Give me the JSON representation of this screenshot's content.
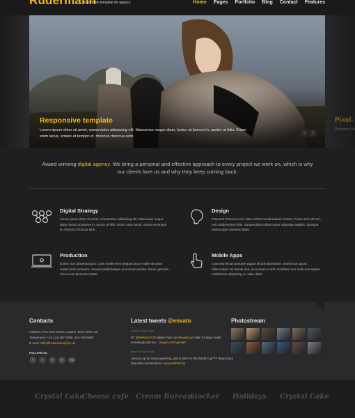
{
  "header": {
    "logo": "Rudermann",
    "tagline": "A portfolio template for agency",
    "nav": [
      "Home",
      "Pages",
      "Portfolio",
      "Blog",
      "Contact",
      "Features"
    ]
  },
  "slider": {
    "title": "Responsive template",
    "text": "Lorem ipsum dolor sit amet, consectetur adipiscing elit. Maecenas neque diam, luctus at laoreet in, auctor ut felis. Etiam enim lacus, ornare et tempor et, rhoncus rhoncus sem.",
    "next_peek_title": "Pixel-",
    "next_peek_text": "Praesent / rhoncus / rhoncus",
    "prev_arrow": "‹",
    "next_arrow": "›"
  },
  "intro": {
    "before": "Award winning ",
    "highlight": "digital agency",
    "after": ". We bring a personal and effective approach to every project we work on, which is why our clients love us and why they keep coming back."
  },
  "features": [
    {
      "title": "Digital Strategy",
      "icon": "network-icon",
      "text": "Lorem ipsum dolor sit amet, consectetur adipiscing elit. Maecenas neque diam, luctus at laoreet in, auctor ut felis. Etiam enim lacus, ornare et tempor et, rhoncus rhoncus sem."
    },
    {
      "title": "Design",
      "icon": "lightbulb-icon",
      "text": "Praesent rhoncus nunc vitae metus condimentum viverra. Fusce sed est orci, vel condimentum felis. Suspendisse ullamcorper vulputate sagittis. Quisque ullamcorper euismod diam."
    },
    {
      "title": "Production",
      "icon": "laptop-icon",
      "text": "Donec non placerat lacus. Cras mollis enim tempus lacus mollis sit amet mattis tortor posuere. Aenean pellentesque accumsan iaculis. Donec gravida nisi vel est pharetra mattis."
    },
    {
      "title": "Mobile Apps",
      "icon": "touch-hand-icon",
      "text": "Cras sed lectus posuere augue dictum bibendum. Sed lectus quam, ullamcorper vel lacinia sed, accumsan a velit. Curabitur non nulla non sapien vestibulum adipiscing eu vitae dolor."
    }
  ],
  "footer": {
    "contacts_title": "Contacts",
    "address": "Address: 77a First Street, London, 5C1A 4RT, UK",
    "telephones": "Telephones: +44 123-457-7890, 321-765-0987",
    "email_label": "E-mail: ",
    "email": "hello@rudermann@co.uk",
    "follow_label": "FOLLOW US:",
    "socials": [
      "f",
      "t",
      "v",
      "in",
      "rss"
    ],
    "tweets_title": "Latest tweets ",
    "tweets_handle": "@envato",
    "tweets": [
      {
        "meta": "about 15 hours ago",
        "text_before": "RT ",
        "link1": "@theMOLTOR",
        "text_mid": " Slides from my ",
        "link2": "#envatoLive",
        "text_mid2": " talk: 5 things I wish somebody told me... ",
        "link3": "tinyurl.com/nsec9ef"
      },
      {
        "meta": "about 16 hours ago",
        "text_before": "Are you up for some guessing, just in time for the World Cup™? Read more about the contest here: ",
        "link1": "envat.to/EWCup",
        "text_mid": "",
        "link2": "",
        "text_mid2": "",
        "link3": ""
      }
    ],
    "photostream_title": "Photostream",
    "photos": [
      "#8a7a5e",
      "#b89a6a",
      "#5a4a3c",
      "#6f7d8a",
      "#7c6a58",
      "#4a5560",
      "#3a4e5e",
      "#8c5a3a",
      "#506a7c",
      "#2f5d86",
      "#6a4a4a",
      "#7a7f88"
    ]
  },
  "clients": [
    "Crystal Cake",
    "Cheese cafe",
    "Cream Bureau",
    "Stocker",
    "Holidays",
    "Crystal Cake"
  ]
}
